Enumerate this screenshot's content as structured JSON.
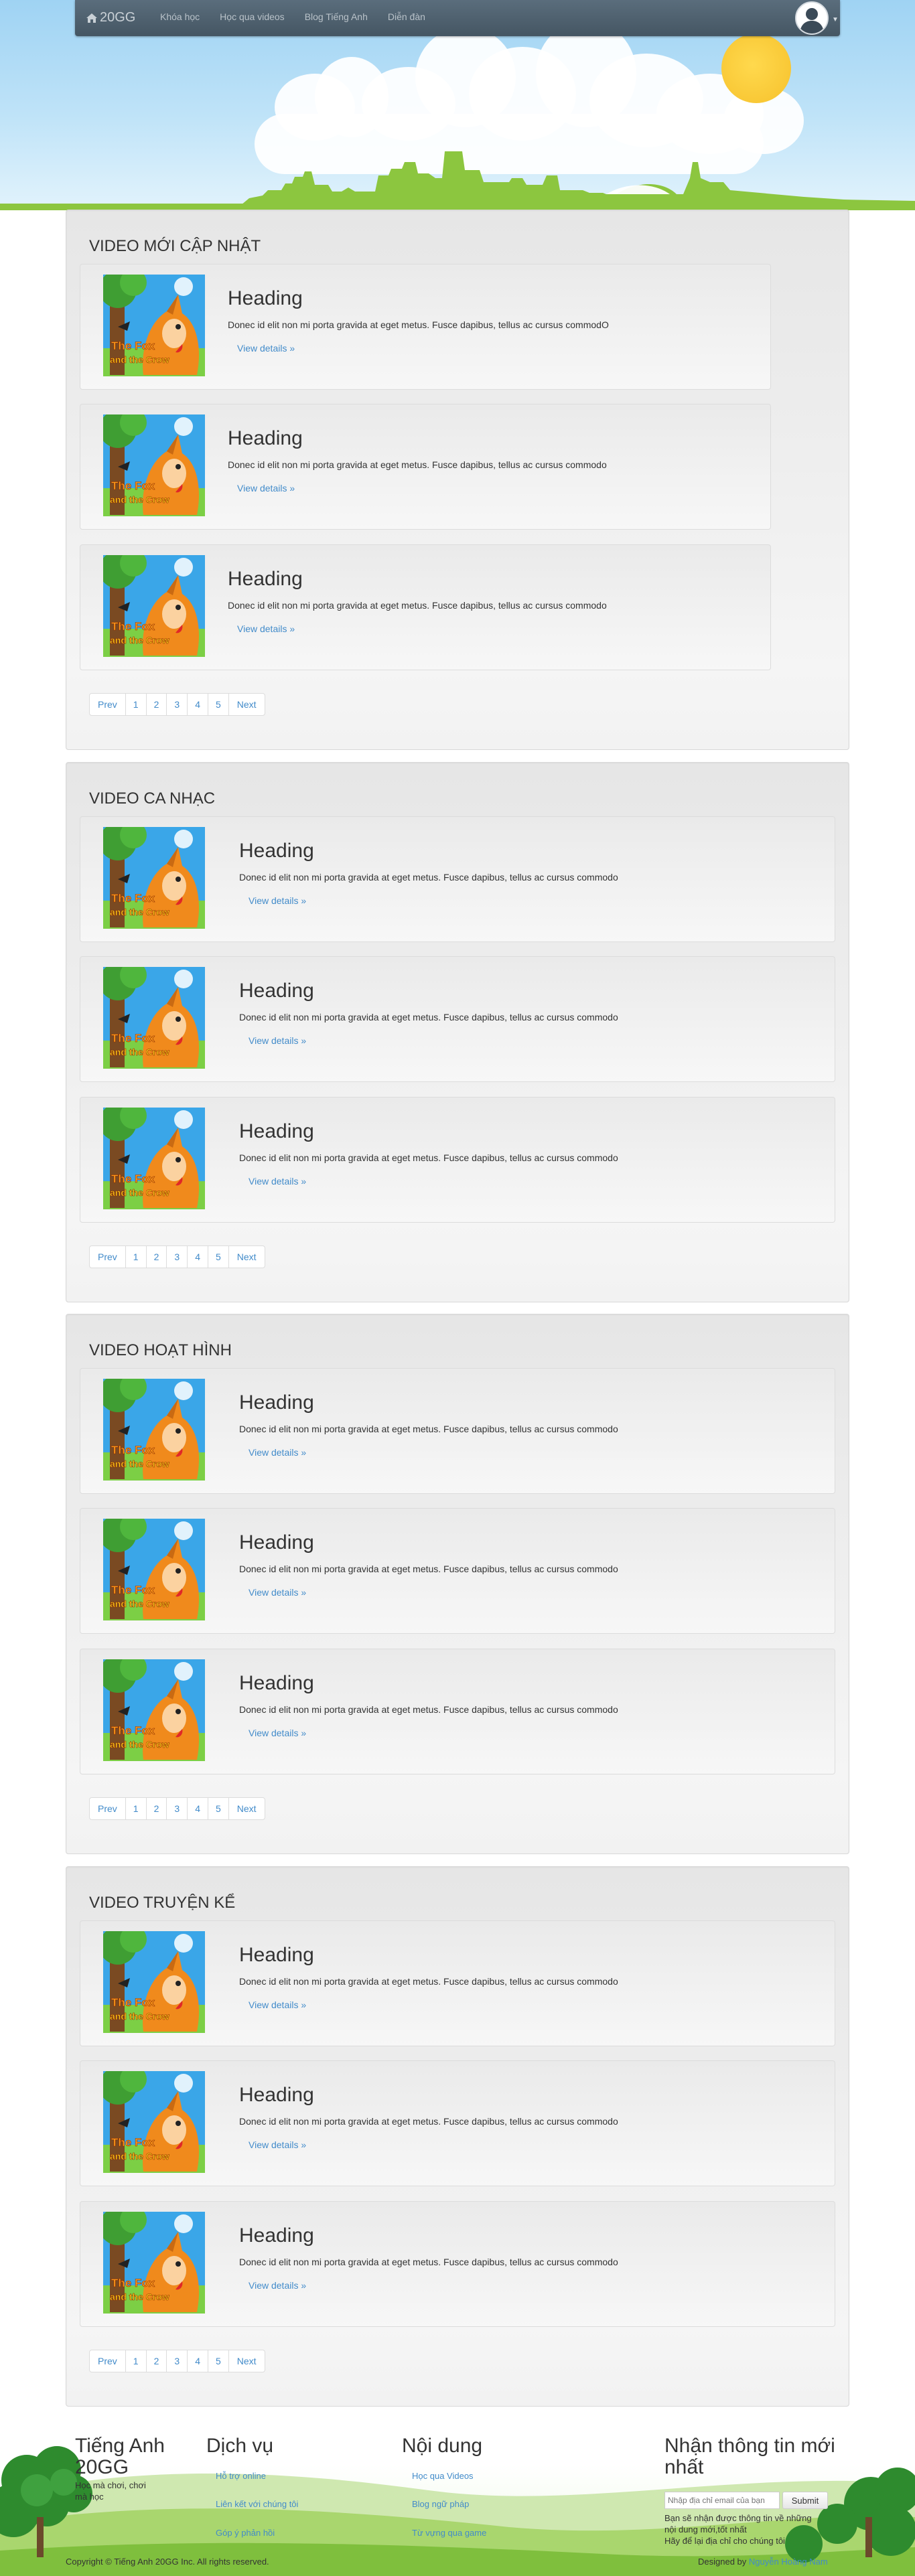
{
  "nav": {
    "brand": "20GG",
    "links": [
      "Khóa học",
      "Học qua videos",
      "Blog Tiếng Anh",
      "Diễn đàn"
    ]
  },
  "thumbnail": {
    "title_line1": "The Fox",
    "title_line2": "and the Crow"
  },
  "sections": [
    {
      "title": "VIDEO MỚI CẬP NHẬT",
      "cards": [
        {
          "heading": "Heading",
          "text": "Donec id elit non mi porta gravida at eget metus. Fusce dapibus, tellus ac cursus commodO",
          "link": "View details »"
        },
        {
          "heading": "Heading",
          "text": "Donec id elit non mi porta gravida at eget metus. Fusce dapibus, tellus ac cursus commodo",
          "link": "View details »"
        },
        {
          "heading": "Heading",
          "text": "Donec id elit non mi porta gravida at eget metus. Fusce dapibus, tellus ac cursus commodo",
          "link": "View details »"
        }
      ]
    },
    {
      "title": "VIDEO CA NHẠC",
      "cards": [
        {
          "heading": "Heading",
          "text": "Donec id elit non mi porta gravida at eget metus. Fusce dapibus, tellus ac cursus commodo",
          "link": "View details »"
        },
        {
          "heading": "Heading",
          "text": "Donec id elit non mi porta gravida at eget metus. Fusce dapibus, tellus ac cursus commodo",
          "link": "View details »"
        },
        {
          "heading": "Heading",
          "text": "Donec id elit non mi porta gravida at eget metus. Fusce dapibus, tellus ac cursus commodo",
          "link": "View details »"
        }
      ]
    },
    {
      "title": "VIDEO HOẠT HÌNH",
      "cards": [
        {
          "heading": "Heading",
          "text": "Donec id elit non mi porta gravida at eget metus. Fusce dapibus, tellus ac cursus commodo",
          "link": "View details »"
        },
        {
          "heading": "Heading",
          "text": "Donec id elit non mi porta gravida at eget metus. Fusce dapibus, tellus ac cursus commodo",
          "link": "View details »"
        },
        {
          "heading": "Heading",
          "text": "Donec id elit non mi porta gravida at eget metus. Fusce dapibus, tellus ac cursus commodo",
          "link": "View details »"
        }
      ]
    },
    {
      "title": "VIDEO TRUYỆN KỂ",
      "cards": [
        {
          "heading": "Heading",
          "text": "Donec id elit non mi porta gravida at eget metus. Fusce dapibus, tellus ac cursus commodo",
          "link": "View details »"
        },
        {
          "heading": "Heading",
          "text": "Donec id elit non mi porta gravida at eget metus. Fusce dapibus, tellus ac cursus commodo",
          "link": "View details »"
        },
        {
          "heading": "Heading",
          "text": "Donec id elit non mi porta gravida at eget metus. Fusce dapibus, tellus ac cursus commodo",
          "link": "View details »"
        }
      ]
    }
  ],
  "pagination": {
    "prev": "Prev",
    "pages": [
      "1",
      "2",
      "3",
      "4",
      "5"
    ],
    "next": "Next"
  },
  "footer": {
    "brand_title": "Tiếng Anh 20GG",
    "brand_tagline": "Học mà chơi, chơi mà học",
    "services_title": "Dịch vụ",
    "services_links": [
      "Hỗ trợ online",
      "Liên kết với chúng tôi",
      "Góp ý phản hồi"
    ],
    "content_title": "Nội dung",
    "content_links": [
      "Học qua Videos",
      "Blog ngữ pháp",
      "Từ vựng qua game"
    ],
    "newsletter_title": "Nhận thông tin mới nhất",
    "email_placeholder": "Nhập địa chỉ email của bạn",
    "submit_label": "Submit",
    "newsletter_lines": [
      "Bạn sẽ nhận được thông tin về những",
      "nội dung mới,tốt nhất",
      "Hãy để lại địa chỉ cho chúng tôi"
    ],
    "copyright": "Copyright © Tiếng Anh 20GG Inc. All rights reserved.",
    "designed_prefix": "Designed by",
    "designed_by": "Nguyễn Hoàng Nam"
  },
  "colors": {
    "navbar": "#4f6170",
    "link": "#428bca",
    "grass": "#8cc63f",
    "sun": "#f6c12c"
  }
}
